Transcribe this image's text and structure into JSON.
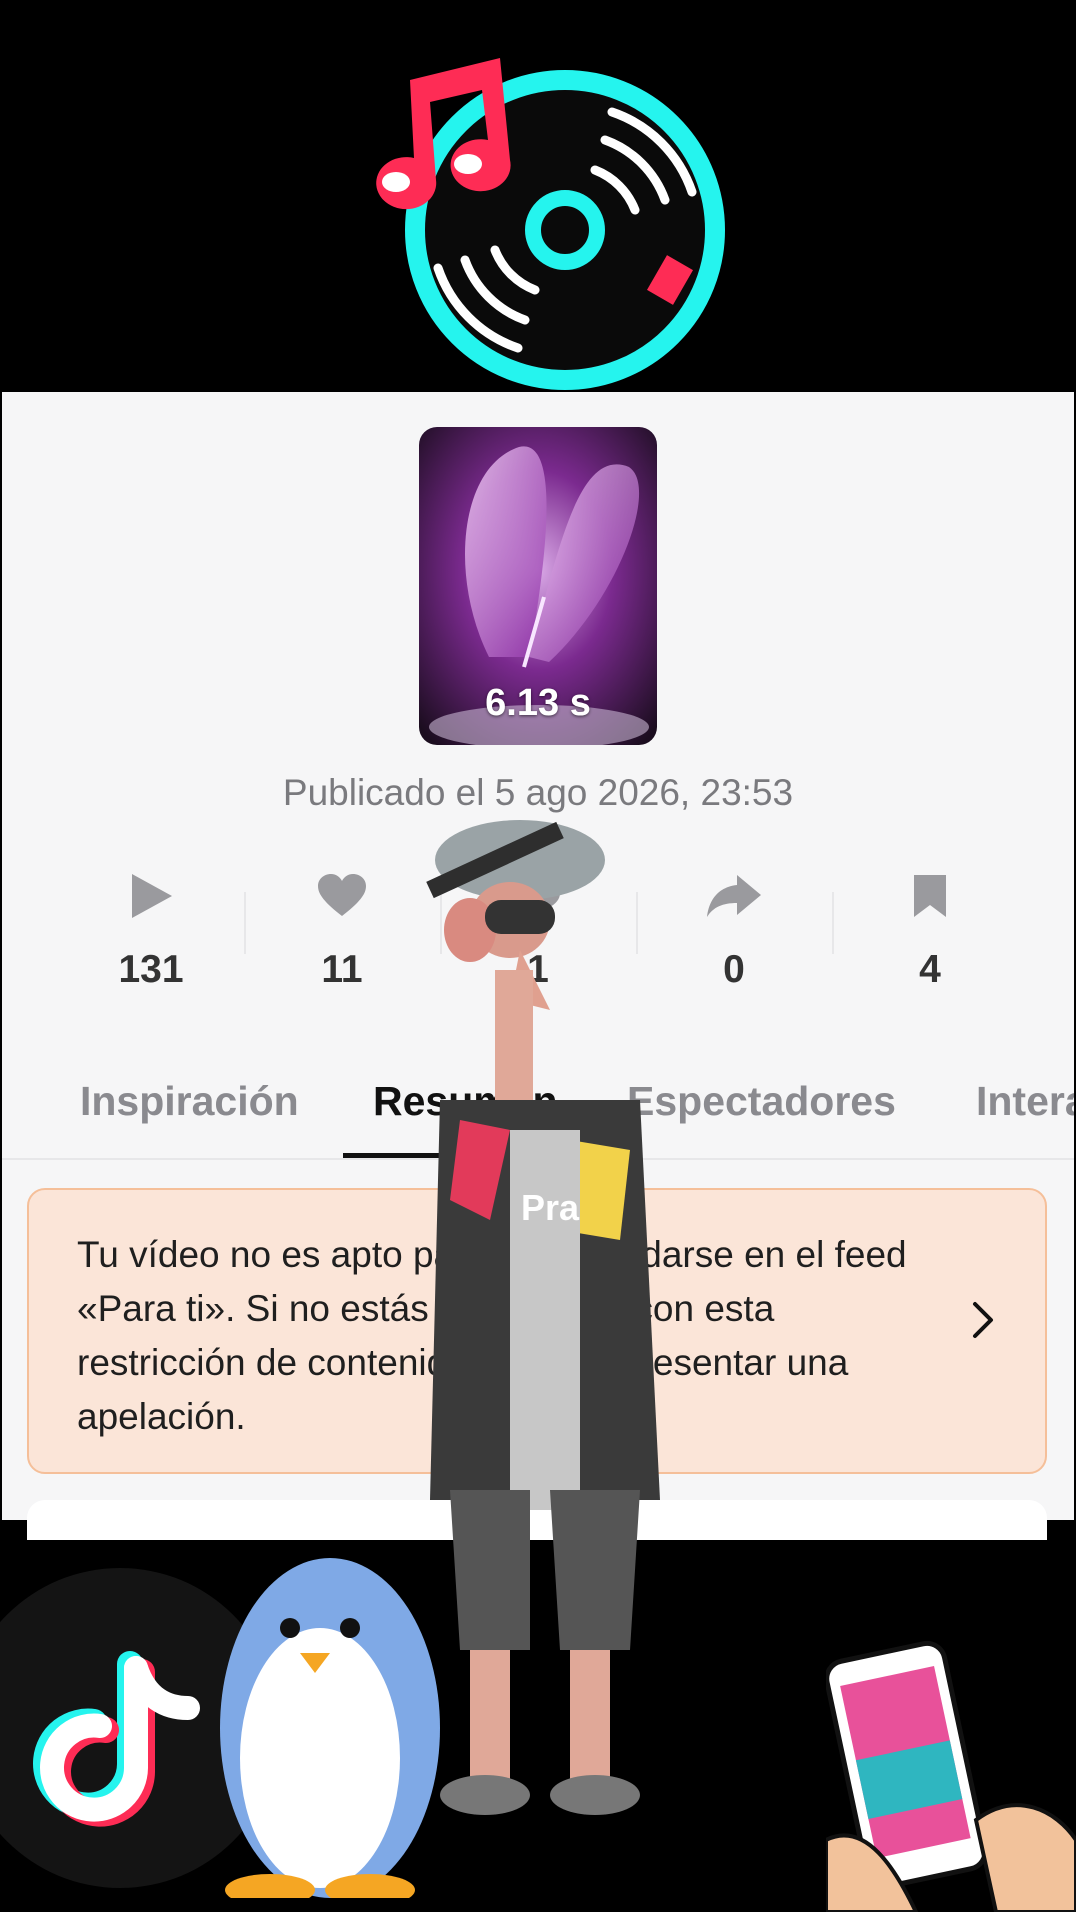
{
  "video": {
    "duration": "6.13 s",
    "published": "Publicado el 5 ago 2026, 23:53"
  },
  "stats": [
    {
      "icon": "play-icon",
      "value": "131"
    },
    {
      "icon": "heart-icon",
      "value": "11"
    },
    {
      "icon": "comment-icon",
      "value": "1"
    },
    {
      "icon": "share-icon",
      "value": "0"
    },
    {
      "icon": "bookmark-icon",
      "value": "4"
    }
  ],
  "tabs": [
    {
      "label": "Inspiración",
      "active": false
    },
    {
      "label": "Resumen",
      "active": true
    },
    {
      "label": "Espectadores",
      "active": false
    },
    {
      "label": "Interacción",
      "active": false
    }
  ],
  "notice": {
    "text": "Tu vídeo no es apto para recomendarse en el feed «Para ti». Si no estás de acuerdo con esta restricción de contenido, puedes presentar una apelación."
  },
  "colors": {
    "panel_bg": "#f6f6f7",
    "notice_bg": "#fbe5d8",
    "notice_border": "#f5bf99",
    "tiktok_cyan": "#25f4ee",
    "tiktok_red": "#fe2c55"
  }
}
